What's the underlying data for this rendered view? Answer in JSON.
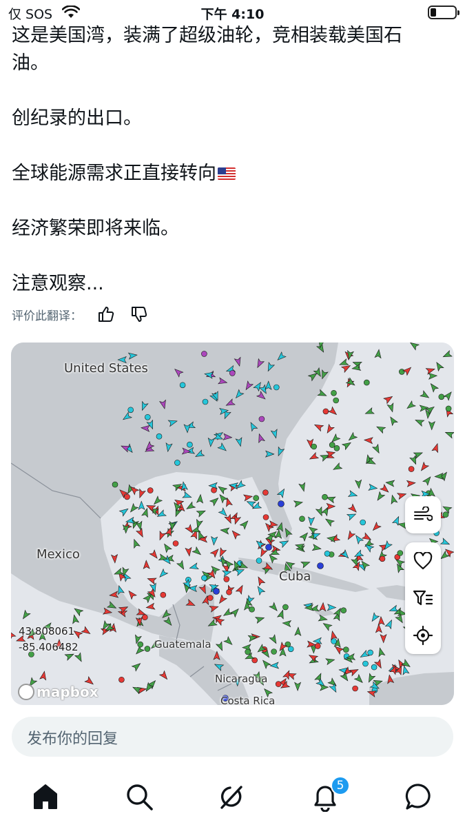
{
  "status_bar": {
    "carrier": "仅 SOS",
    "time": "下午 4:10"
  },
  "tweet": {
    "lines": [
      "这是美国湾，装满了超级油轮，竞相装载美国石",
      "油。",
      "创纪录的出口。",
      "全球能源需求正直接转向",
      "经济繁荣即将来临。",
      "注意观察..."
    ],
    "flag_icon": "us-flag-emoji"
  },
  "translation_rating": {
    "label": "评价此翻译："
  },
  "map": {
    "labels": {
      "united_states": "United States",
      "mexico": "Mexico",
      "cuba": "Cuba",
      "guatemala": "Guatemala",
      "nicaragua": "Nicaragua",
      "costa_rica": "Costa Rica"
    },
    "coordinates": {
      "lat": "43.808061",
      "lon": "-85.406482"
    },
    "attribution": "mapbox",
    "controls": [
      "wind-icon",
      "heart-icon",
      "filter-list-icon",
      "locate-icon"
    ],
    "colors": {
      "land": "#c6cacf",
      "water": "#e3e6eb",
      "tanker": "#e53935",
      "cargo": "#43a047",
      "other": "#26c6da",
      "passenger": "#ab47bc",
      "tug": "#2a3fd6"
    }
  },
  "reply": {
    "placeholder": "发布你的回复"
  },
  "nav": {
    "items": [
      "home-icon",
      "search-icon",
      "grok-icon",
      "notifications-icon",
      "messages-icon"
    ],
    "notification_count": "5"
  }
}
